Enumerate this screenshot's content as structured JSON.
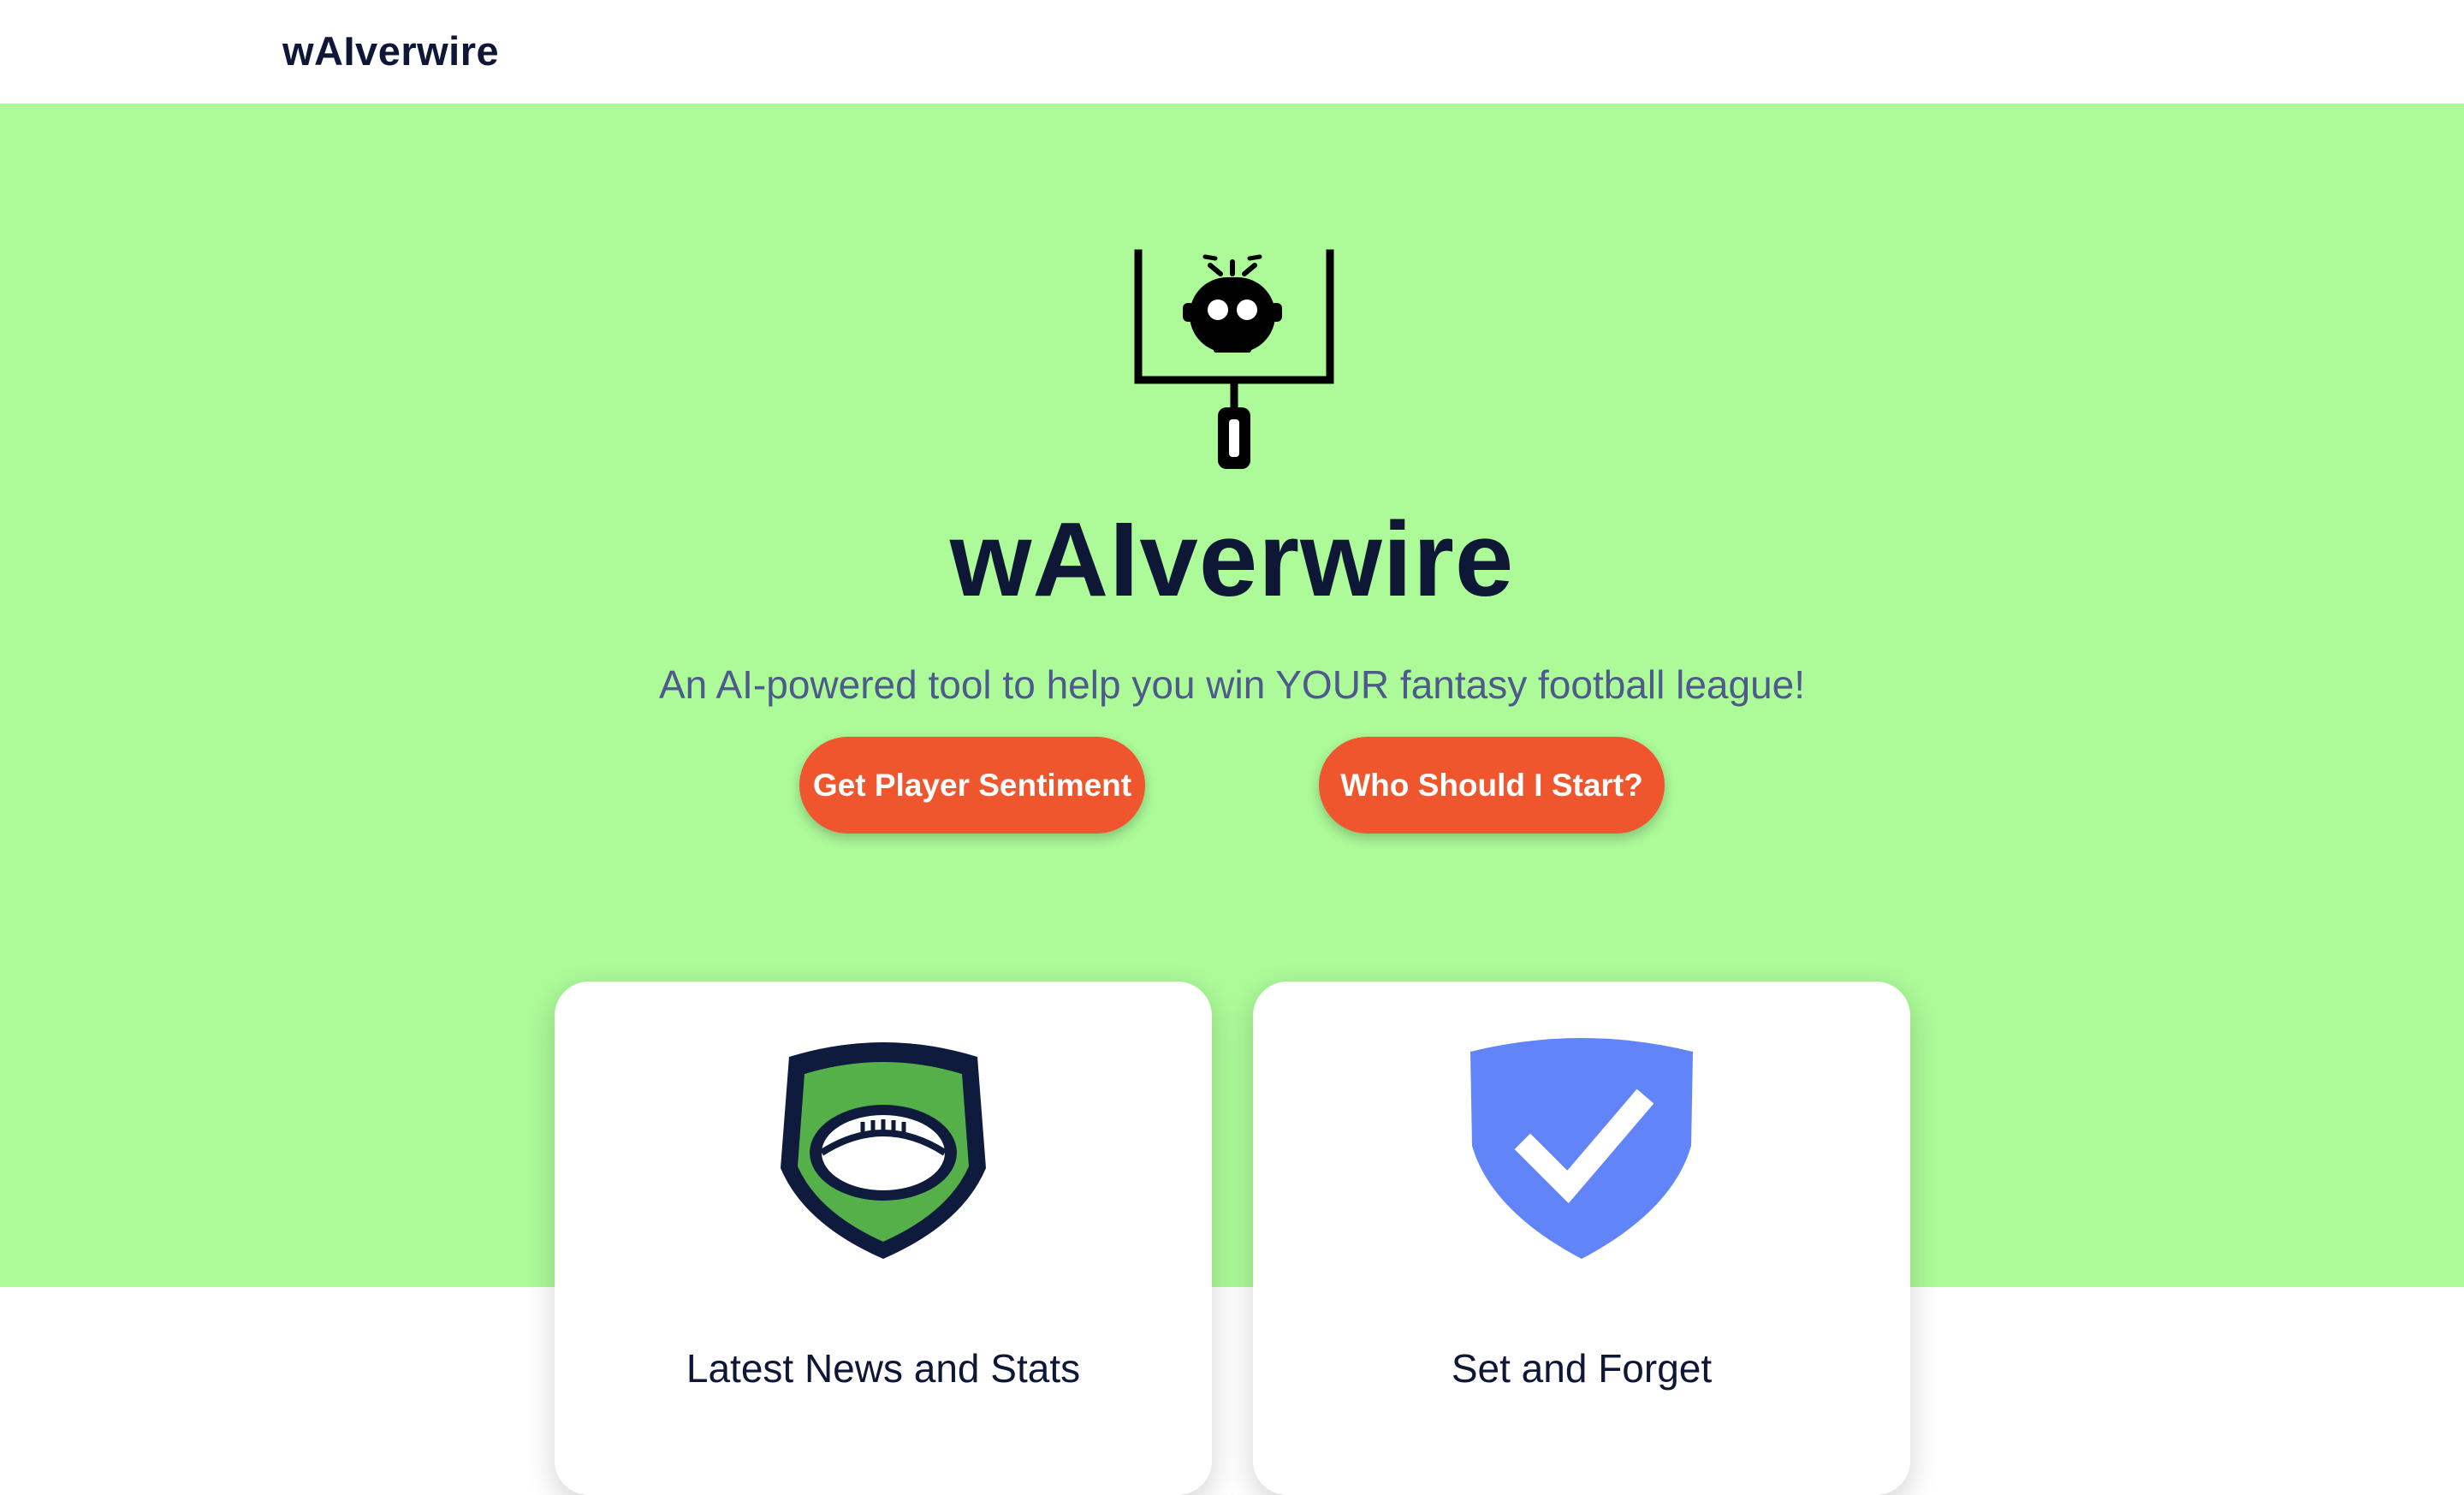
{
  "nav": {
    "brand": "wAIverwire"
  },
  "hero": {
    "logo_icon": "goalpost-robot-icon",
    "title": "wAIverwire",
    "subtitle": "An AI-powered tool to help you win YOUR fantasy football league!",
    "buttons": [
      {
        "label": "Get Player Sentiment"
      },
      {
        "label": "Who Should I Start?"
      }
    ]
  },
  "features": [
    {
      "icon": "football-shield-icon",
      "title": "Latest News and Stats"
    },
    {
      "icon": "checkmark-shield-icon",
      "title": "Set and Forget"
    }
  ],
  "colors": {
    "hero_background": "#acfa98",
    "button": "#ef562d",
    "text_dark": "#0f1737",
    "subtitle": "#4e5a8c",
    "shield_blue": "#6185f8",
    "shield_green": "#55b04a",
    "shield_navy": "#0e1b3d"
  }
}
